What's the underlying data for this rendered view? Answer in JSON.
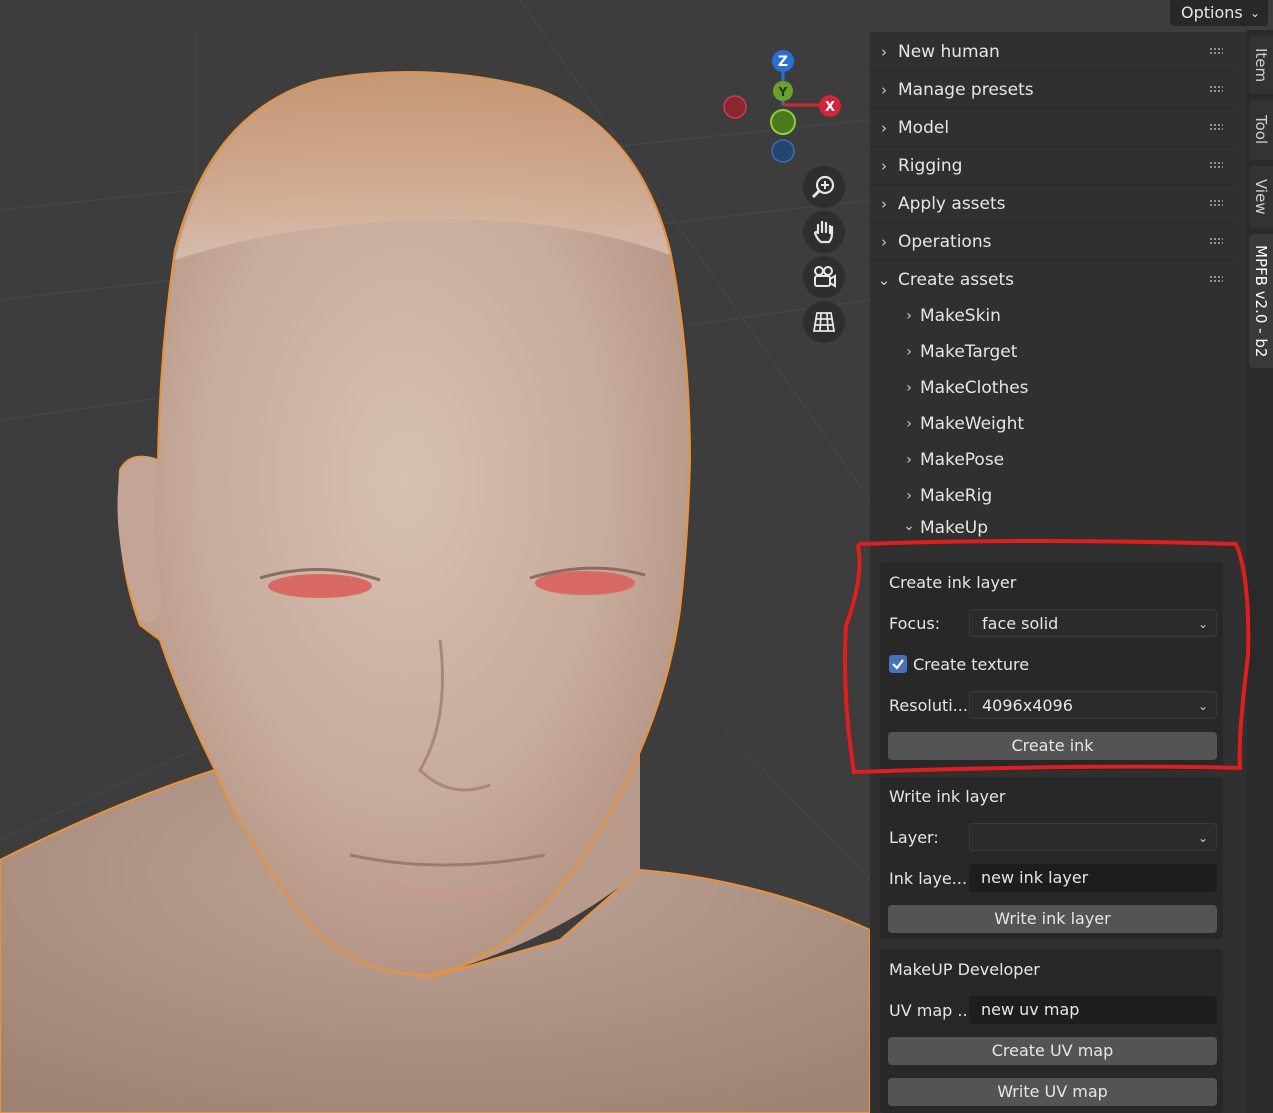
{
  "header": {
    "options_label": "Options"
  },
  "gizmo": {
    "z": "Z",
    "y": "Y",
    "x": "X"
  },
  "tabs": [
    "Item",
    "Tool",
    "View",
    "MPFB v2.0 - b2"
  ],
  "panels": [
    "New human",
    "Manage presets",
    "Model",
    "Rigging",
    "Apply assets",
    "Operations",
    "Create assets"
  ],
  "create_assets_items": [
    "MakeSkin",
    "MakeTarget",
    "MakeClothes",
    "MakeWeight",
    "MakePose",
    "MakeRig",
    "MakeUp"
  ],
  "create_ink": {
    "title": "Create ink layer",
    "focus_label": "Focus:",
    "focus_value": "face solid",
    "create_texture_label": "Create texture",
    "create_texture_checked": true,
    "resolution_label": "Resoluti...",
    "resolution_value": "4096x4096",
    "button": "Create ink"
  },
  "write_ink": {
    "title": "Write ink layer",
    "layer_label": "Layer:",
    "layer_value": "",
    "ink_layer_label": "Ink laye...",
    "ink_layer_value": "new ink layer",
    "button": "Write ink layer"
  },
  "makeup_dev": {
    "title": "MakeUP Developer",
    "uv_map_label": "UV map ...",
    "uv_map_value": "new uv map",
    "create_button": "Create UV map",
    "write_button": "Write UV map"
  },
  "colors": {
    "accent": "#4772b3",
    "outline": "#e8923a",
    "highlight": "#e01e1e"
  }
}
